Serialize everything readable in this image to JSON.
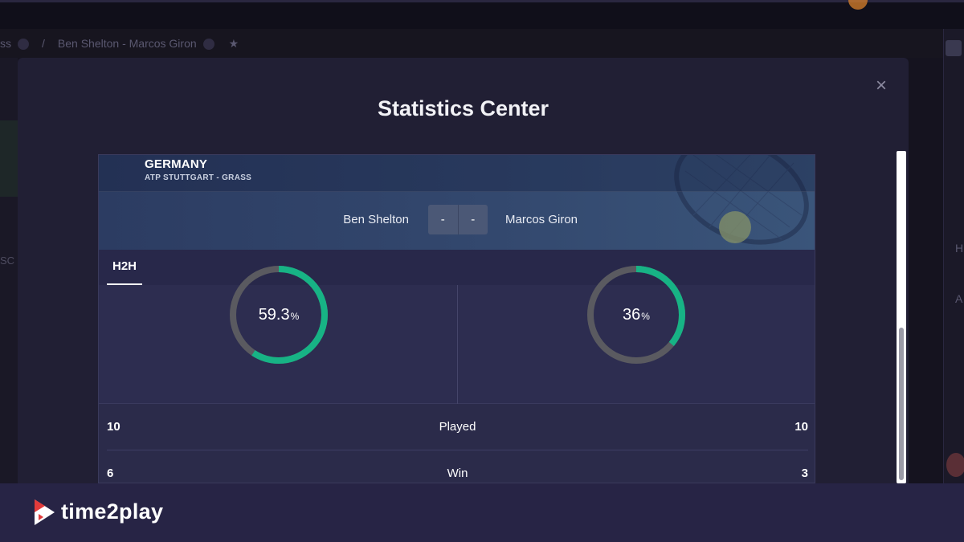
{
  "background": {
    "breadcrumb": {
      "prev": "ss",
      "current": "Ben Shelton - Marcos Giron"
    },
    "left_text": "SC",
    "right_h": "H",
    "right_a": "A"
  },
  "modal": {
    "title": "Statistics Center",
    "close_label": "×"
  },
  "match": {
    "country": "GERMANY",
    "tournament": "ATP STUTTGART - GRASS",
    "player1": "Ben Shelton",
    "player2": "Marcos Giron",
    "score1": "-",
    "score2": "-"
  },
  "tabs": [
    {
      "label": "H2H"
    }
  ],
  "gauges": {
    "left": {
      "value": "59.3",
      "unit": "%",
      "percent": 59.3,
      "color": "#17b385"
    },
    "right": {
      "value": "36",
      "unit": "%",
      "percent": 36,
      "color": "#17b385"
    }
  },
  "stats": [
    {
      "label": "Played",
      "left": "10",
      "right": "10"
    },
    {
      "label": "Win",
      "left": "6",
      "right": "3"
    }
  ],
  "footer": {
    "brand": "time2play"
  },
  "colors": {
    "accent": "#17b385",
    "modal_bg": "#211f34",
    "widget_bg": "#2b2b4a"
  }
}
